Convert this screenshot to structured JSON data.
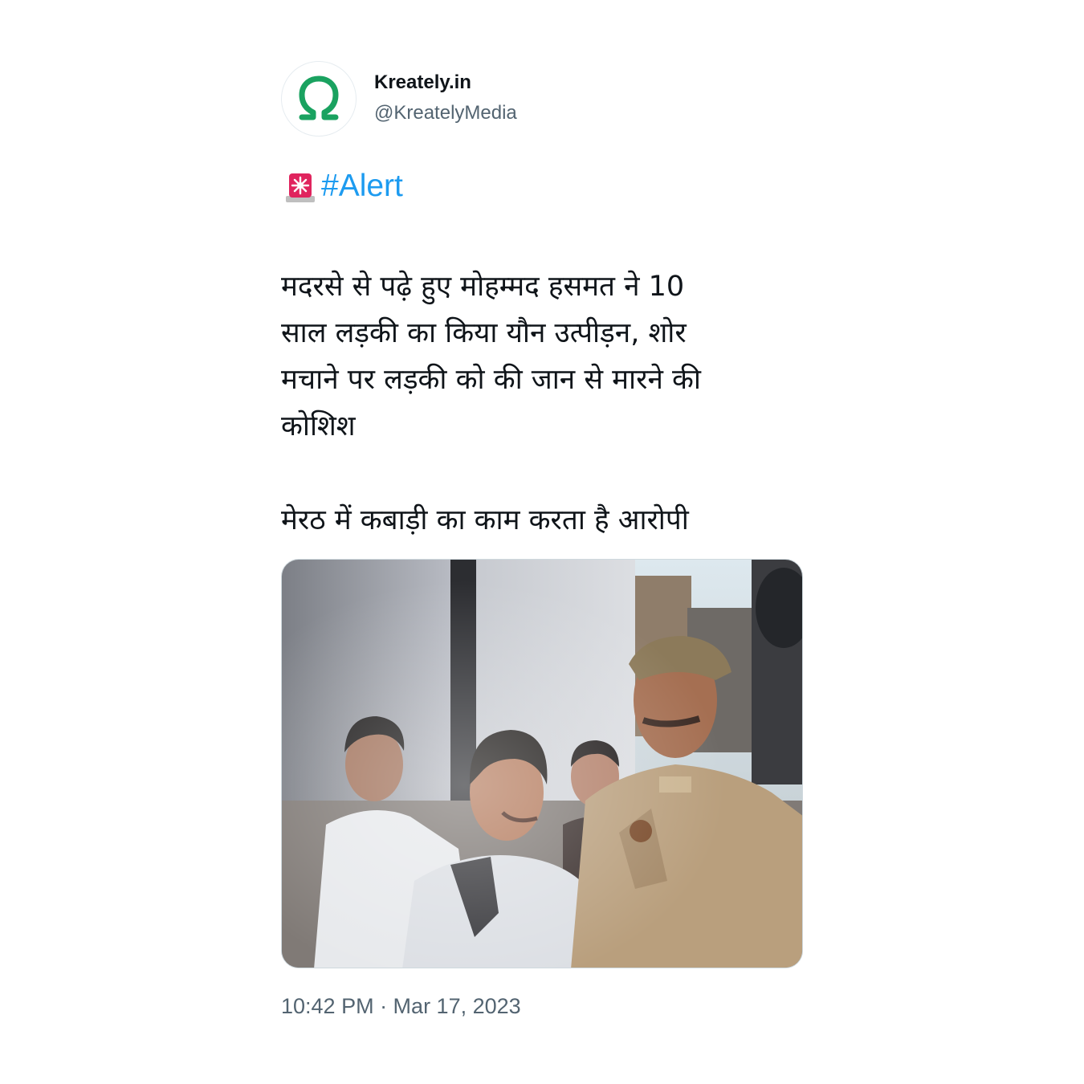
{
  "author": {
    "display_name": "Kreately.in",
    "handle": "@KreatelyMedia",
    "avatar_icon": "omega-logo-icon",
    "avatar_color": "#1aa260"
  },
  "tweet": {
    "alert_icon": "police-siren-icon",
    "hashtag": "#Alert",
    "hashtag_color": "#1d9bf0",
    "paragraph_1_lines": [
      "मदरसे से पढ़े हुए मोहम्मद हसमत ने 10",
      "साल लड़की का किया यौन उत्पीड़न, शोर",
      "मचाने पर लड़की को की जान से मारने की",
      "कोशिश"
    ],
    "paragraph_2": "मेरठ में कबाड़ी का काम करता है आरोपी",
    "timestamp": "10:42 PM · Mar 17, 2023"
  },
  "media": {
    "type": "photo"
  }
}
